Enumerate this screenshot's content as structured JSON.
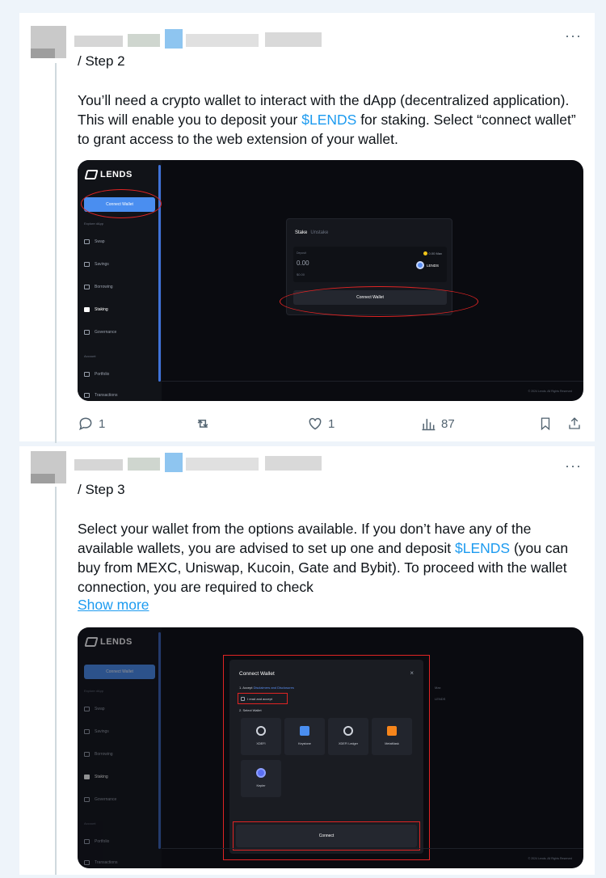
{
  "tweet1": {
    "step": "/ Step 2",
    "text_before": "You’ll need a crypto wallet to interact with the dApp (decentralized application). This will enable you to deposit your ",
    "cashtag": "$LENDS",
    "text_after": " for staking. Select “connect wallet” to grant access to the web extension of your wallet.",
    "more": "···",
    "screenshot": {
      "logo": "LENDS",
      "connect_wallet": "Connect Wallet",
      "section_explore": "Explore dApp",
      "sidebar": [
        "Swap",
        "Savings",
        "Borrowing",
        "Staking",
        "Governance"
      ],
      "section_account": "Account",
      "sidebar_account": [
        "Portfolio",
        "Transactions"
      ],
      "stake_tab": "Stake",
      "unstake_tab": "Unstake",
      "deposit_label": "Deposit",
      "deposit_value": "0.00",
      "deposit_usd": "$0.00",
      "max_label": "0.00 Max",
      "token": "LENDS",
      "connect_button": "Connect Wallet",
      "footer": "© 2024 Lends. All Rights Reserved"
    },
    "actions": {
      "replies": "1",
      "retweets": "",
      "likes": "1",
      "views": "87"
    }
  },
  "tweet2": {
    "step": "/ Step 3",
    "text_before": "Select your wallet from the options available. If you don’t have any of the available wallets, you are advised to set up one and deposit ",
    "cashtag": "$LENDS",
    "text_after": " (you can buy from MEXC, Uniswap, Kucoin, Gate and Bybit). To proceed with the wallet connection, you are required to check",
    "show_more": "Show more",
    "more": "···",
    "screenshot": {
      "logo": "LENDS",
      "connect_wallet": "Connect Wallet",
      "section_explore": "Explore dApp",
      "sidebar": [
        "Swap",
        "Savings",
        "Borrowing",
        "Staking",
        "Governance"
      ],
      "section_account": "Account",
      "sidebar_account": [
        "Portfolio",
        "Transactions"
      ],
      "modal_title": "Connect Wallet",
      "step1_prefix": "1. Accept ",
      "step1_link": "Disclaimers and Disclosures",
      "checkbox": "I read and accept",
      "step2": "2. Select Wallet",
      "wallets": [
        "XDEFI",
        "Keystone",
        "XDEFI Ledger",
        "MetaMask",
        "Kepler"
      ],
      "connect_button": "Connect",
      "footer": "© 2024 Lends. All Rights Reserved",
      "bg_max": "Max",
      "bg_token": "LENDS"
    }
  },
  "colors": {
    "accent": "#1d9bf0",
    "highlight": "#e02424",
    "app_bg": "#0a0b10",
    "app_button": "#4a8ef0"
  }
}
